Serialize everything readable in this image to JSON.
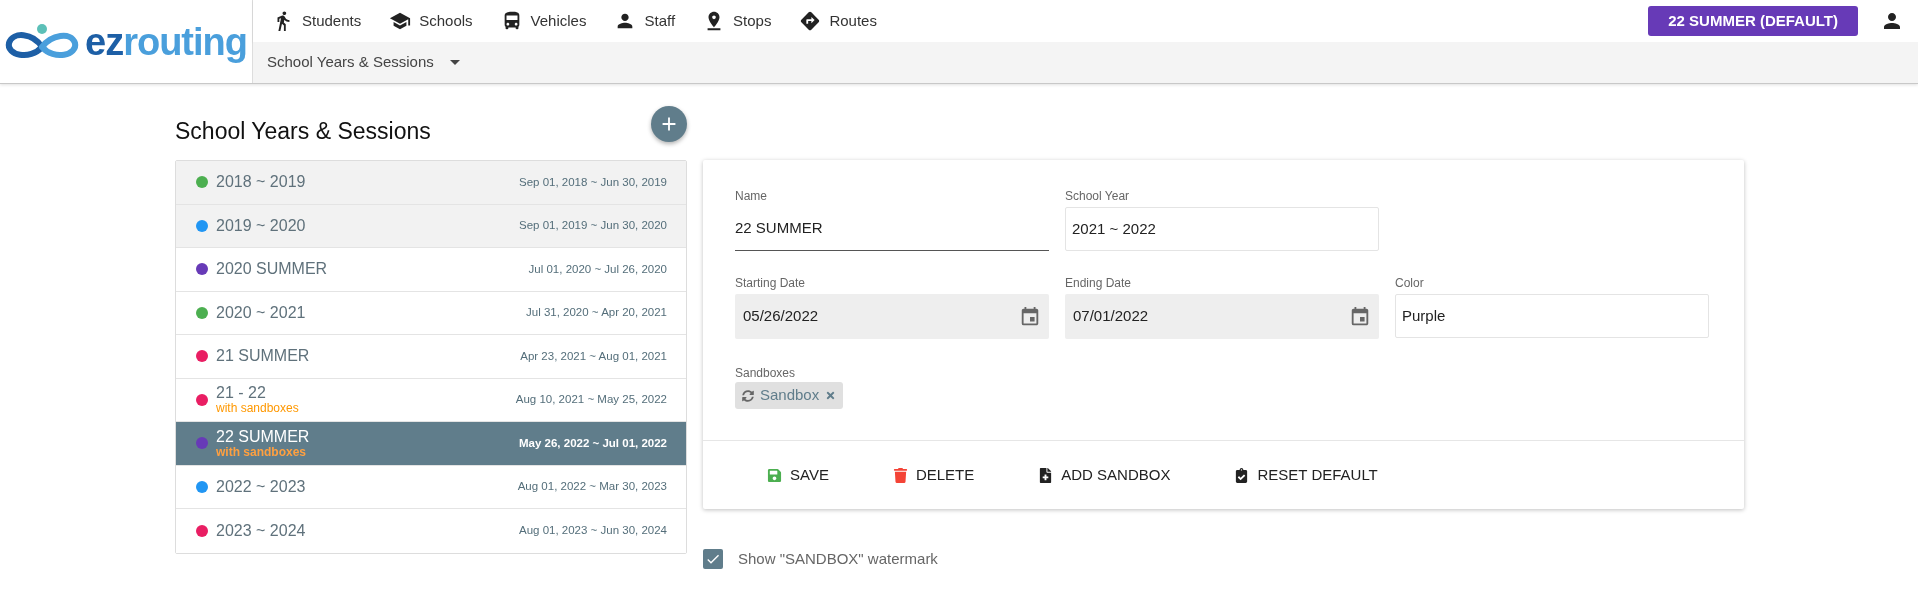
{
  "logo": {
    "prefix": "ez",
    "suffix": "routing"
  },
  "nav": {
    "items": [
      "Students",
      "Schools",
      "Vehicles",
      "Staff",
      "Stops",
      "Routes"
    ],
    "session_button": "22 SUMMER (DEFAULT)"
  },
  "subnav": {
    "label": "School Years & Sessions"
  },
  "sessions": {
    "title": "School Years & Sessions",
    "items": [
      {
        "name": "2018 ~ 2019",
        "dates": "Sep 01, 2018 ~ Jun 30, 2019",
        "color": "#4caf50",
        "selected": false,
        "shaded": true
      },
      {
        "name": "2019 ~ 2020",
        "dates": "Sep 01, 2019 ~ Jun 30, 2020",
        "color": "#2196f3",
        "selected": false,
        "shaded": true
      },
      {
        "name": "2020 SUMMER",
        "dates": "Jul 01, 2020 ~ Jul 26, 2020",
        "color": "#673ab7",
        "selected": false,
        "shaded": false
      },
      {
        "name": "2020 ~ 2021",
        "dates": "Jul 31, 2020 ~ Apr 20, 2021",
        "color": "#4caf50",
        "selected": false,
        "shaded": false
      },
      {
        "name": "21 SUMMER",
        "dates": "Apr 23, 2021 ~ Aug 01, 2021",
        "color": "#e91e63",
        "selected": false,
        "shaded": false
      },
      {
        "name": "21 - 22",
        "note": "with sandboxes",
        "dates": "Aug 10, 2021 ~ May 25, 2022",
        "color": "#e91e63",
        "selected": false,
        "shaded": false
      },
      {
        "name": "22 SUMMER",
        "note": "with sandboxes",
        "dates": "May 26, 2022 ~ Jul 01, 2022",
        "color": "#673ab7",
        "selected": true,
        "shaded": false
      },
      {
        "name": "2022 ~ 2023",
        "dates": "Aug 01, 2022 ~ Mar 30, 2023",
        "color": "#2196f3",
        "selected": false,
        "shaded": false
      },
      {
        "name": "2023 ~ 2024",
        "dates": "Aug 01, 2023 ~ Jun 30, 2024",
        "color": "#e91e63",
        "selected": false,
        "shaded": false
      }
    ]
  },
  "form": {
    "field_rows": [
      [
        {
          "kind": "underline",
          "label": "Name",
          "value": "22 SUMMER"
        },
        {
          "kind": "outlined",
          "label": "School Year",
          "value": "2021 ~ 2022"
        }
      ],
      [
        {
          "kind": "date",
          "label": "Starting Date",
          "value": "05/26/2022"
        },
        {
          "kind": "date",
          "label": "Ending Date",
          "value": "07/01/2022"
        },
        {
          "kind": "outlined",
          "label": "Color",
          "value": "Purple"
        }
      ]
    ],
    "sandboxes": {
      "label": "Sandboxes",
      "chips": [
        "Sandbox"
      ]
    },
    "actions": [
      "SAVE",
      "DELETE",
      "ADD SANDBOX",
      "RESET DEFAULT"
    ]
  },
  "watermark_option": {
    "label": "Show \"SANDBOX\" watermark",
    "checked": true
  }
}
